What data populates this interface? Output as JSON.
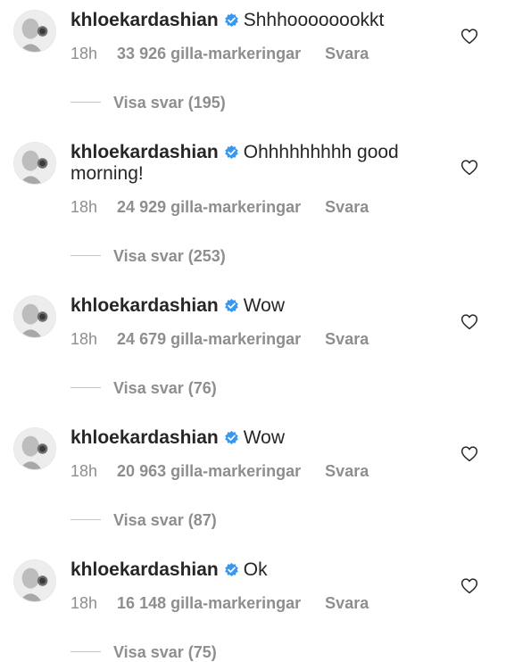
{
  "comments": [
    {
      "username": "khloekardashian",
      "text": "Shhhoooooookkt",
      "time": "18h",
      "likes": "33 926 gilla-markeringar",
      "reply_label": "Svara",
      "view_replies": "Visa svar (195)"
    },
    {
      "username": "khloekardashian",
      "text": "Ohhhhhhhhh good morning!",
      "time": "18h",
      "likes": "24 929 gilla-markeringar",
      "reply_label": "Svara",
      "view_replies": "Visa svar (253)"
    },
    {
      "username": "khloekardashian",
      "text": "Wow",
      "time": "18h",
      "likes": "24 679 gilla-markeringar",
      "reply_label": "Svara",
      "view_replies": "Visa svar (76)"
    },
    {
      "username": "khloekardashian",
      "text": "Wow",
      "time": "18h",
      "likes": "20 963 gilla-markeringar",
      "reply_label": "Svara",
      "view_replies": "Visa svar (87)"
    },
    {
      "username": "khloekardashian",
      "text": "Ok",
      "time": "18h",
      "likes": "16 148 gilla-markeringar",
      "reply_label": "Svara",
      "view_replies": "Visa svar (75)"
    }
  ],
  "icons": {
    "avatar": "avatar-photo",
    "verified": "verified-badge-icon",
    "like": "heart-outline-icon"
  },
  "colors": {
    "text": "#262626",
    "meta": "#8e8e8e",
    "verified": "#3897f0",
    "divider": "#c7c7c7"
  }
}
